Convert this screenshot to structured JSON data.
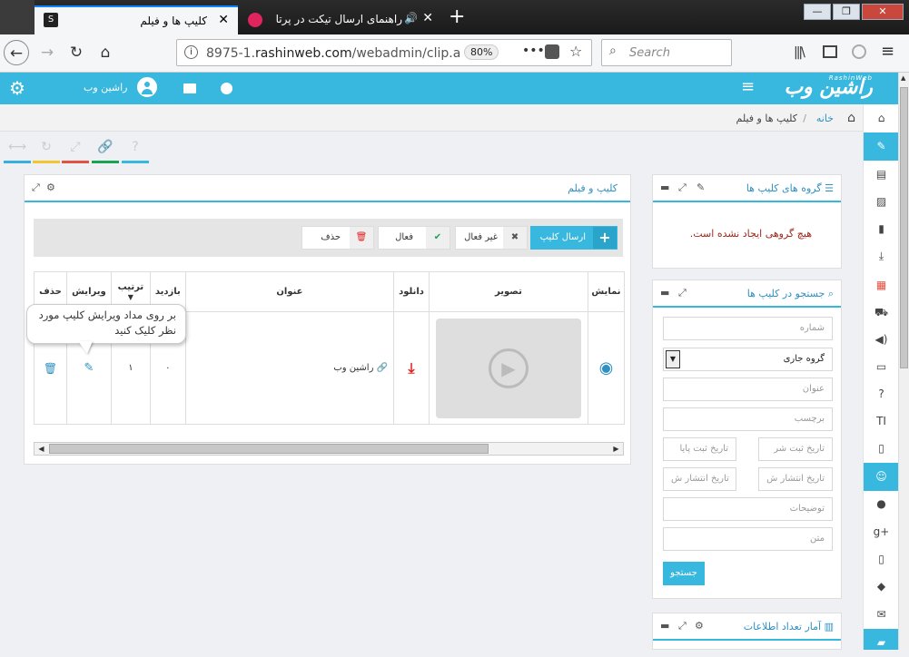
{
  "browser": {
    "tabs": [
      {
        "title": "کلیپ ها و فیلم",
        "active": true
      },
      {
        "title": "راهنمای ارسال تیکت در پرتال ...",
        "active": false
      }
    ],
    "new_tab_symbol": "+",
    "url_prefix": "8975-1.",
    "url_domain": "rashinweb.com",
    "url_path": "/webadmin/clip.a",
    "zoom": "80%",
    "search_placeholder": "Search",
    "window_controls": {
      "minimize": "—",
      "maximize": "❐",
      "close": "✕"
    }
  },
  "header": {
    "logo_text": "راشین وب",
    "logo_sub": "RashinWeb",
    "user_name": "راشین وب"
  },
  "breadcrumb": {
    "home": "خانه",
    "separator": "/",
    "current": "کلیپ ها و فیلم"
  },
  "groups_panel": {
    "title": "گروه های کلیپ ها",
    "empty_message": "هیچ گروهی ایجاد نشده است."
  },
  "search_panel": {
    "title": "جستجو در کلیپ ها",
    "number_placeholder": "شماره",
    "group_select": "گروه جاری",
    "title_placeholder": "عنوان",
    "tag_placeholder": "برچسب",
    "reg_start_placeholder": "تاریخ ثبت شر",
    "reg_end_placeholder": "تاریخ ثبت پایا",
    "pub_start_placeholder": "تاریخ انتشار ش",
    "pub_end_placeholder": "تاریخ انتشار ش",
    "desc_placeholder": "توضیحات",
    "text_placeholder": "متن",
    "search_button": "جستجو"
  },
  "stats_panel": {
    "title": "آمار تعداد اطلاعات"
  },
  "main_panel": {
    "title": "کلیپ و فیلم",
    "toolbar": {
      "send": "ارسال کلیپ",
      "inactive": "غیر فعال",
      "active": "فعال",
      "delete": "حذف"
    },
    "columns": {
      "show": "نمایش",
      "image": "تصویر",
      "download": "دانلود",
      "title": "عنوان",
      "visits": "بازدید",
      "order": "ترتیب",
      "edit": "ویرایش",
      "delete": "حذف"
    },
    "rows": [
      {
        "title": "راشین وب",
        "visits": "۰",
        "order": "۱"
      }
    ],
    "tooltip": "بر روی مداد ویرایش کلیپ مورد نظر کلیک کنید"
  },
  "colors": {
    "accent": "#38b8de",
    "tab_bar": "#1a1a1a",
    "toolstrip": [
      "#3aaee0",
      "#f3c531",
      "#e25244",
      "#1aa354",
      "#38b8de"
    ]
  },
  "icons": {
    "sidebar": [
      "home-icon",
      "pencil-icon",
      "newspaper-icon",
      "image-icon",
      "document-icon",
      "download-icon",
      "film-icon",
      "cart-icon",
      "volume-icon",
      "monitor-icon",
      "question-icon",
      "text-icon",
      "file-icon",
      "users-icon",
      "user-icon",
      "google-plus-icon",
      "mobile-icon",
      "comments-icon",
      "mail-icon",
      "folder-icon"
    ]
  }
}
